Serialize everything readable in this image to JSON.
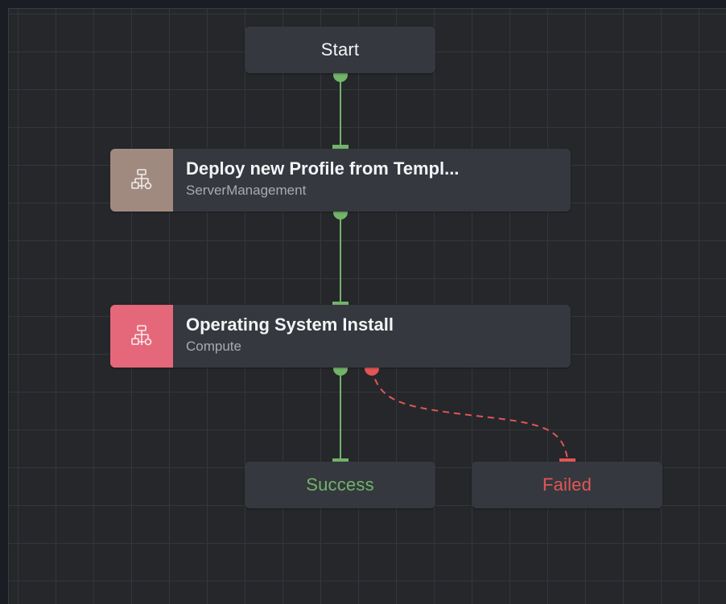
{
  "nodes": {
    "start": {
      "label": "Start"
    },
    "deploy": {
      "title": "Deploy new Profile from Templ...",
      "subtitle": "ServerManagement",
      "icon": "workflow-icon",
      "accent": "#a08a80"
    },
    "os_install": {
      "title": "Operating System Install",
      "subtitle": "Compute",
      "icon": "workflow-icon",
      "accent": "#e4687a"
    },
    "success": {
      "label": "Success",
      "color": "#72b46a"
    },
    "failed": {
      "label": "Failed",
      "color": "#e25656"
    }
  },
  "colors": {
    "success_link": "#72b46a",
    "failure_link": "#e25656",
    "terminal_text": "#f3f4f6"
  }
}
